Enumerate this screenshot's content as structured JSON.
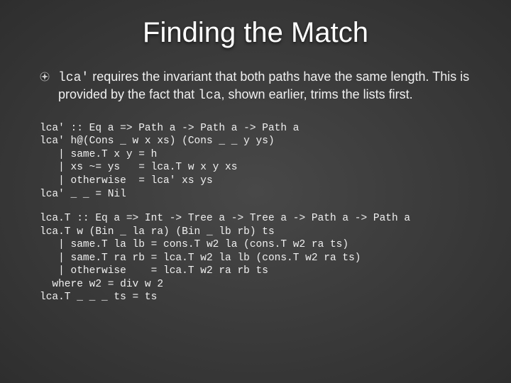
{
  "title": "Finding the Match",
  "bullet": {
    "code1": "lca'",
    "text1": " requires the invariant that both paths have the same length. This is provided by the fact that ",
    "code2": "lca",
    "text2": ", shown earlier, trims the lists first."
  },
  "code1": "lca' :: Eq a => Path a -> Path a -> Path a\nlca' h@(Cons _ w x xs) (Cons _ _ y ys)\n   | same.T x y = h\n   | xs ~= ys   = lca.T w x y xs\n   | otherwise  = lca' xs ys\nlca' _ _ = Nil",
  "code2": "lca.T :: Eq a => Int -> Tree a -> Tree a -> Path a -> Path a\nlca.T w (Bin _ la ra) (Bin _ lb rb) ts\n   | same.T la lb = cons.T w2 la (cons.T w2 ra ts)\n   | same.T ra rb = lca.T w2 la lb (cons.T w2 ra ts)\n   | otherwise    = lca.T w2 ra rb ts\n  where w2 = div w 2\nlca.T _ _ _ ts = ts"
}
